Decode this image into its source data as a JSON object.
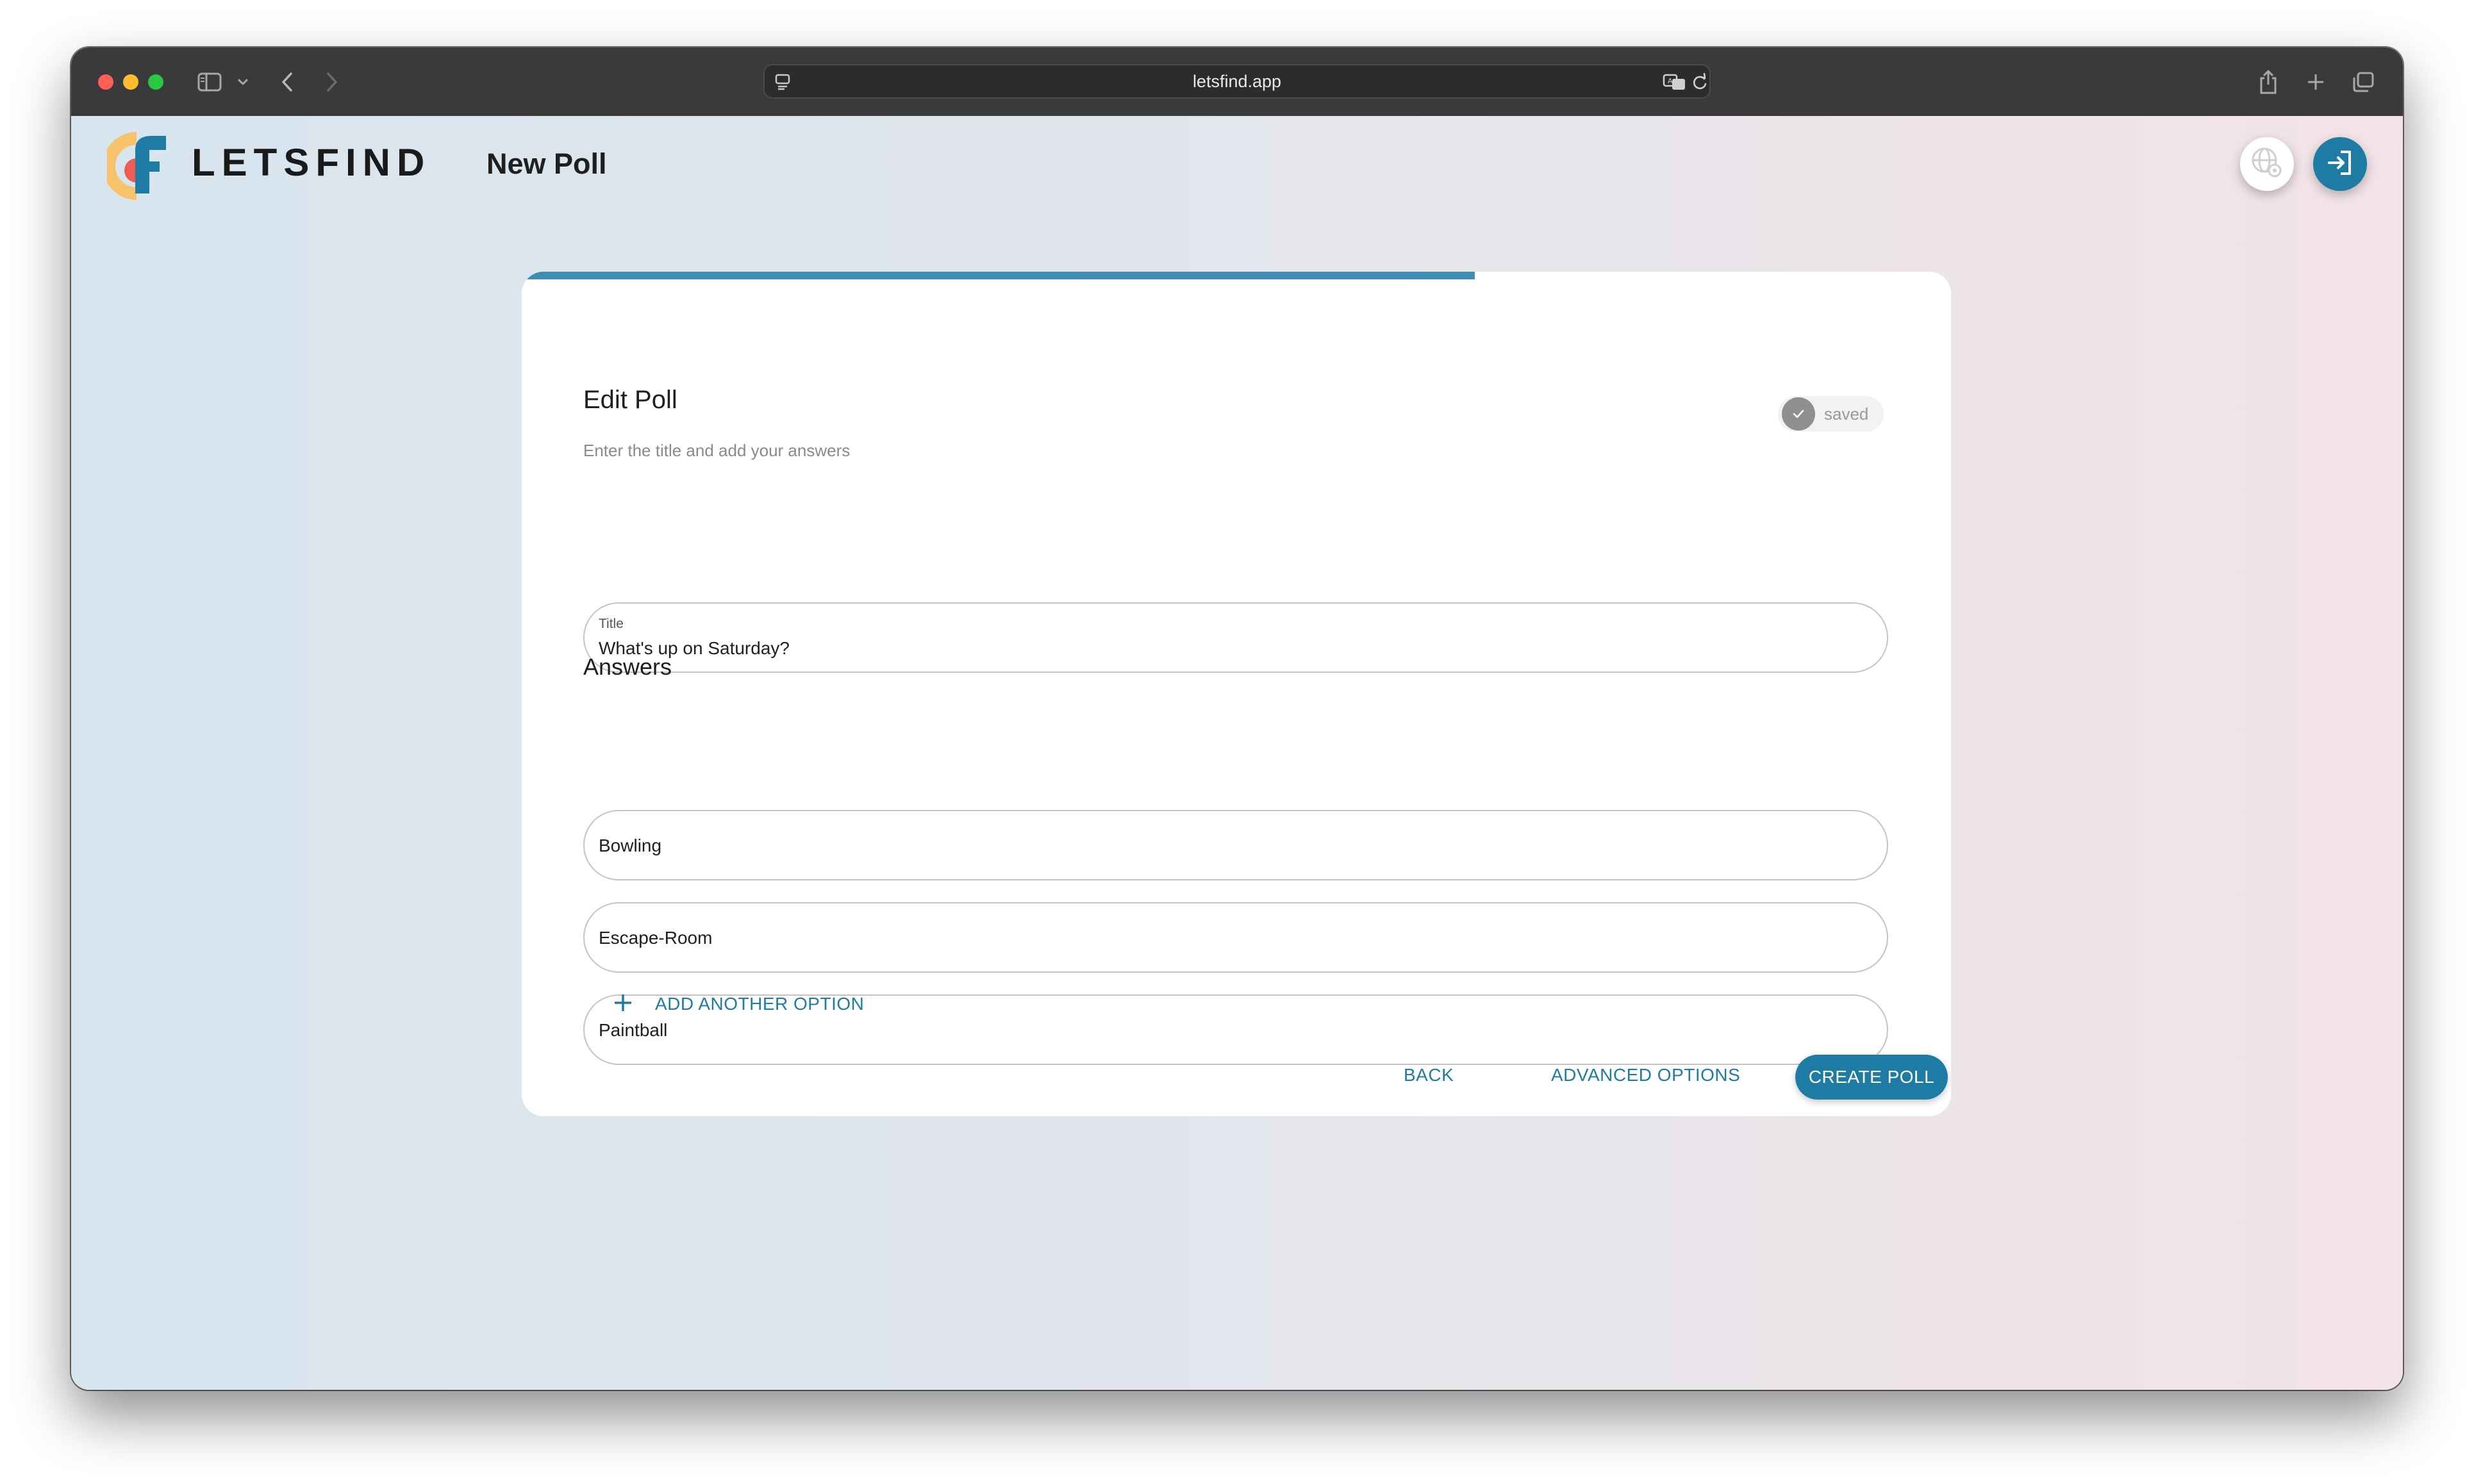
{
  "browser": {
    "url": "letsfind.app",
    "icons": [
      "sidebar-icon",
      "chevron-down-icon",
      "back-icon",
      "forward-icon",
      "site-settings-icon",
      "translate-icon",
      "reload-icon",
      "share-icon",
      "new-tab-icon",
      "tabs-overview-icon"
    ]
  },
  "header": {
    "brand": "LETSFIND",
    "page_title": "New Poll",
    "actions": [
      "language-settings-icon",
      "login-icon"
    ]
  },
  "colors": {
    "accent": "#1e7ba3",
    "progress": "#3f8db2",
    "status_gray": "#8f8f8f"
  },
  "card": {
    "progress": 0.667,
    "title": "Edit Poll",
    "subtitle": "Enter the title and add your answers",
    "status": "saved",
    "title_field": {
      "label": "Title",
      "value": "What's up on Saturday?"
    },
    "answers_heading": "Answers",
    "answers": [
      {
        "value": "Bowling"
      },
      {
        "value": "Escape-Room"
      },
      {
        "value": "Paintball"
      }
    ],
    "add_option_label": "ADD ANOTHER OPTION",
    "buttons": {
      "back": "BACK",
      "advanced": "ADVANCED OPTIONS",
      "create": "CREATE POLL"
    }
  }
}
